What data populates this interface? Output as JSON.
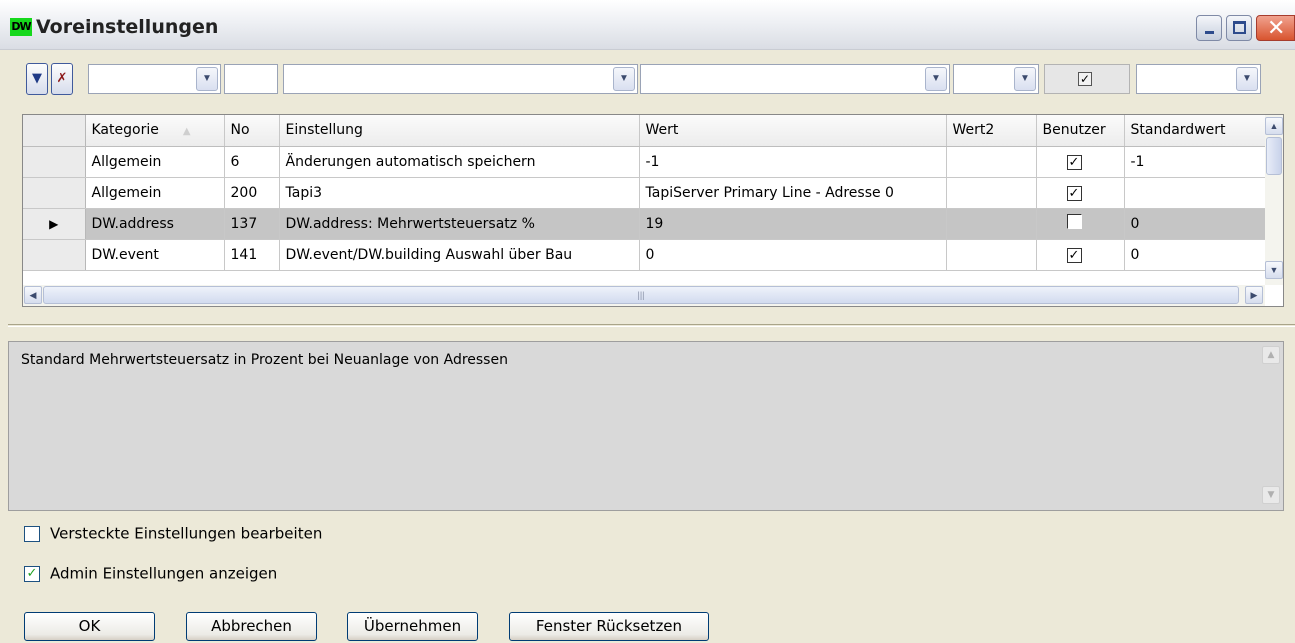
{
  "window": {
    "icon_text": "DW",
    "title": "Voreinstellungen"
  },
  "toolbar": {
    "filter_checkbox_checked": true
  },
  "grid": {
    "columns": [
      "Kategorie",
      "No",
      "Einstellung",
      "Wert",
      "Wert2",
      "Benutzer",
      "Standardwert"
    ],
    "rows": [
      {
        "kategorie": "Allgemein",
        "no": "6",
        "einstellung": "Änderungen automatisch speichern",
        "wert": "-1",
        "wert2": "",
        "benutzer": true,
        "standardwert": "-1",
        "selected": false
      },
      {
        "kategorie": "Allgemein",
        "no": "200",
        "einstellung": "Tapi3",
        "wert": "TapiServer Primary Line - Adresse 0",
        "wert2": "",
        "benutzer": true,
        "standardwert": "",
        "selected": false
      },
      {
        "kategorie": "DW.address",
        "no": "137",
        "einstellung": "DW.address: Mehrwertsteuersatz %",
        "wert": "19",
        "wert2": "",
        "benutzer": false,
        "standardwert": "0",
        "selected": true
      },
      {
        "kategorie": "DW.event",
        "no": "141",
        "einstellung": "DW.event/DW.building Auswahl über Bau",
        "wert": "0",
        "wert2": "",
        "benutzer": true,
        "standardwert": "0",
        "selected": false
      }
    ]
  },
  "description": "Standard Mehrwertsteuersatz in Prozent bei Neuanlage von Adressen",
  "options": {
    "hidden_settings_label": "Versteckte Einstellungen bearbeiten",
    "hidden_settings_checked": false,
    "admin_settings_label": "Admin Einstellungen anzeigen",
    "admin_settings_checked": true
  },
  "buttons": {
    "ok": "OK",
    "cancel": "Abbrechen",
    "apply": "Übernehmen",
    "reset": "Fenster Rücksetzen"
  }
}
